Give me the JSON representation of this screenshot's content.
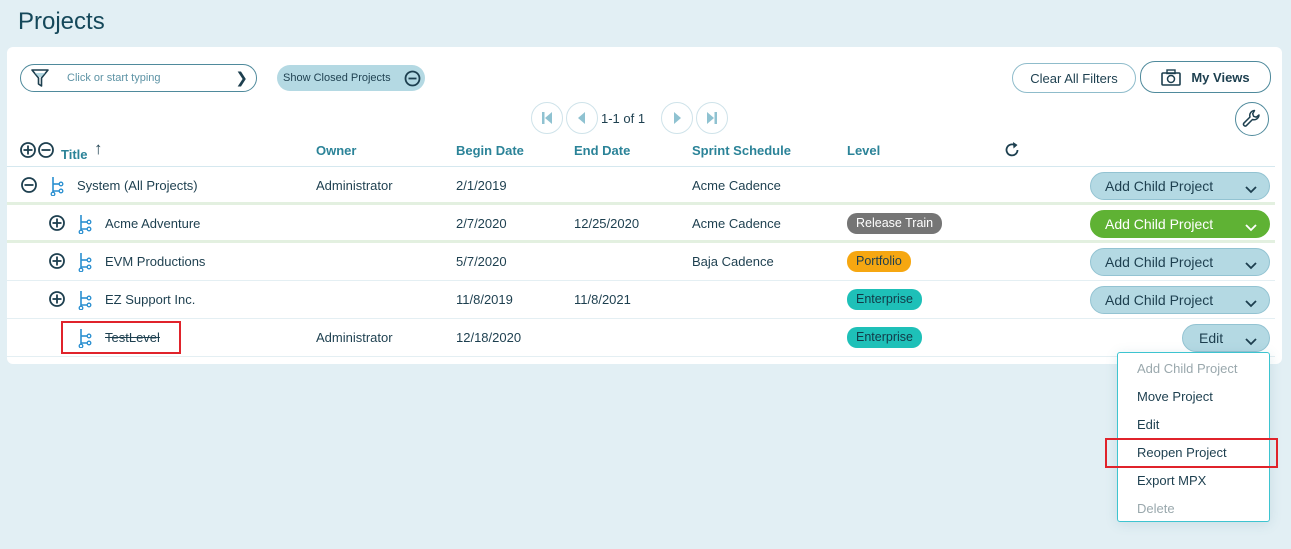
{
  "page": {
    "title": "Projects"
  },
  "toolbar": {
    "filter_placeholder": "Click or start typing",
    "show_closed_label": "Show Closed Projects",
    "clear_filters_label": "Clear All Filters",
    "my_views_label": "My Views"
  },
  "pager": {
    "text": "1-1 of 1"
  },
  "columns": {
    "title": "Title",
    "owner": "Owner",
    "begin_date": "Begin Date",
    "end_date": "End Date",
    "sprint_schedule": "Sprint Schedule",
    "level": "Level"
  },
  "rows": [
    {
      "title": "System (All Projects)",
      "owner": "Administrator",
      "begin_date": "2/1/2019",
      "end_date": "",
      "sprint_schedule": "Acme Cadence",
      "level": "",
      "action": "Add Child Project",
      "expander": "collapse"
    },
    {
      "title": "Acme Adventure",
      "owner": "",
      "begin_date": "2/7/2020",
      "end_date": "12/25/2020",
      "sprint_schedule": "Acme Cadence",
      "level": "Release Train",
      "action": "Add Child Project",
      "expander": "expand"
    },
    {
      "title": "EVM Productions",
      "owner": "",
      "begin_date": "5/7/2020",
      "end_date": "",
      "sprint_schedule": "Baja Cadence",
      "level": "Portfolio",
      "action": "Add Child Project",
      "expander": "expand"
    },
    {
      "title": "EZ Support Inc.",
      "owner": "",
      "begin_date": "11/8/2019",
      "end_date": "11/8/2021",
      "sprint_schedule": "",
      "level": "Enterprise",
      "action": "Add Child Project",
      "expander": "expand"
    },
    {
      "title": "TestLevel",
      "owner": "Administrator",
      "begin_date": "12/18/2020",
      "end_date": "",
      "sprint_schedule": "",
      "level": "Enterprise",
      "action": "Edit",
      "expander": "none",
      "closed": true
    }
  ],
  "level_colors": {
    "Release Train": "#757575",
    "Portfolio": "#f6a711",
    "Enterprise": "#1ec0b8"
  },
  "action_menu": {
    "items": [
      {
        "label": "Add Child Project",
        "disabled": true
      },
      {
        "label": "Move Project",
        "disabled": false
      },
      {
        "label": "Edit",
        "disabled": false
      },
      {
        "label": "Reopen Project",
        "disabled": false,
        "highlighted": true
      },
      {
        "label": "Export MPX",
        "disabled": false
      },
      {
        "label": "Delete",
        "disabled": true
      }
    ]
  },
  "colors": {
    "accent_header": "#2b8398",
    "active_button": "#5fb234",
    "highlight": "#e0232b"
  }
}
